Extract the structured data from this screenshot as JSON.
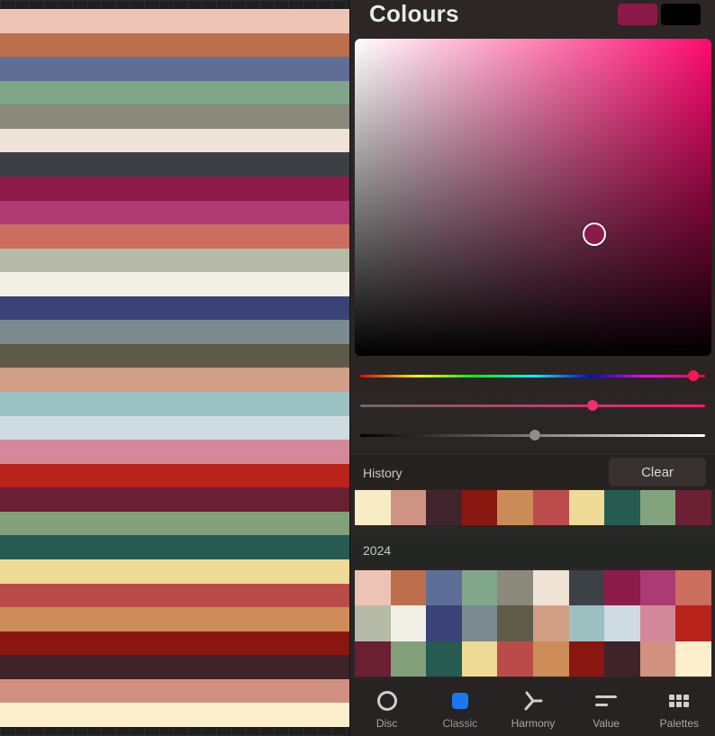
{
  "title": "Colours",
  "current_colours": {
    "primary": "#8b1a4a",
    "secondary": "#000000"
  },
  "canvas": {
    "stripes": [
      "#edc4b6",
      "#bd6f4c",
      "#5f6e97",
      "#7fa689",
      "#8a897c",
      "#efe3d5",
      "#3b4044",
      "#8d1c4b",
      "#ad3a73",
      "#cb6d5f",
      "#b6bba8",
      "#f2f0e6",
      "#3a4278",
      "#7a8a90",
      "#5d5b47",
      "#d19f86",
      "#9cc1c3",
      "#cfdde2",
      "#d4889a",
      "#b8231b",
      "#6a1f32",
      "#82a17a",
      "#255b52",
      "#f0da97",
      "#bb4b49",
      "#cd8c58",
      "#8a170f",
      "#3e232a",
      "#d29180",
      "#fbefcc"
    ]
  },
  "sliders": {
    "hue_color": "#ff1452",
    "saturation_color": "#ee2f73",
    "brightness_color": "#8d8d8d"
  },
  "history": {
    "label": "History",
    "clear_label": "Clear",
    "swatches": [
      "#f8ecc5",
      "#cf9384",
      "#40242b",
      "#89170f",
      "#cb8b56",
      "#bc4c4b",
      "#efda98",
      "#275b51",
      "#82a37d",
      "#6b2033"
    ]
  },
  "palette": {
    "label": "2024",
    "swatches": [
      "#edc3b5",
      "#bd6f4c",
      "#5f6e97",
      "#80a78a",
      "#8a897c",
      "#efe3d5",
      "#3b4145",
      "#8e1c4a",
      "#ac3a74",
      "#cb6d5f",
      "#b6bba8",
      "#f1efe6",
      "#3a4278",
      "#7a8a90",
      "#5e5c48",
      "#d19f86",
      "#9cc0c1",
      "#cedbe1",
      "#d3889a",
      "#b8231b",
      "#6a1f32",
      "#82a17a",
      "#265b52",
      "#efd997",
      "#bb4b49",
      "#cd8c58",
      "#8a170f",
      "#3e232a",
      "#d29180",
      "#fbefcc"
    ]
  },
  "nav": {
    "disc_label": "Disc",
    "classic_label": "Classic",
    "harmony_label": "Harmony",
    "value_label": "Value",
    "palettes_label": "Palettes",
    "active": "classic"
  }
}
